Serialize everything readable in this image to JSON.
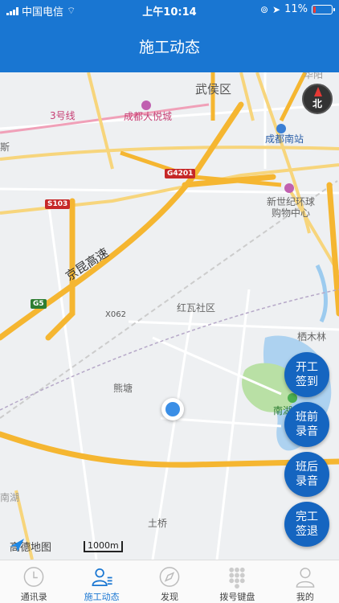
{
  "status": {
    "carrier": "中国电信",
    "time": "上午10:14",
    "battery": "11%"
  },
  "header": {
    "title": "施工动态"
  },
  "map": {
    "labels": [
      "武侯区",
      "成都大悦城",
      "成都南站",
      "新世纪环球",
      "购物中心",
      "3号线",
      "京昆高速",
      "红瓦社区",
      "熊塘",
      "栖木林",
      "南湖",
      "土桥",
      "X062",
      "华阳",
      "南湖",
      "斯"
    ],
    "shields": [
      "G4201",
      "S103",
      "G5"
    ],
    "compass": "北",
    "scale": "1000m",
    "logo": "高德地图"
  },
  "actions": [
    {
      "line1": "开工",
      "line2": "签到"
    },
    {
      "line1": "班前",
      "line2": "录音"
    },
    {
      "line1": "班后",
      "line2": "录音"
    },
    {
      "line1": "完工",
      "line2": "签退"
    }
  ],
  "tabs": [
    "通讯录",
    "施工动态",
    "发现",
    "拨号键盘",
    "我的"
  ],
  "colors": {
    "primary": "#1976d2",
    "fab": "#1565c0",
    "road_major": "#f5b631",
    "road_minor": "#f7d57c"
  }
}
